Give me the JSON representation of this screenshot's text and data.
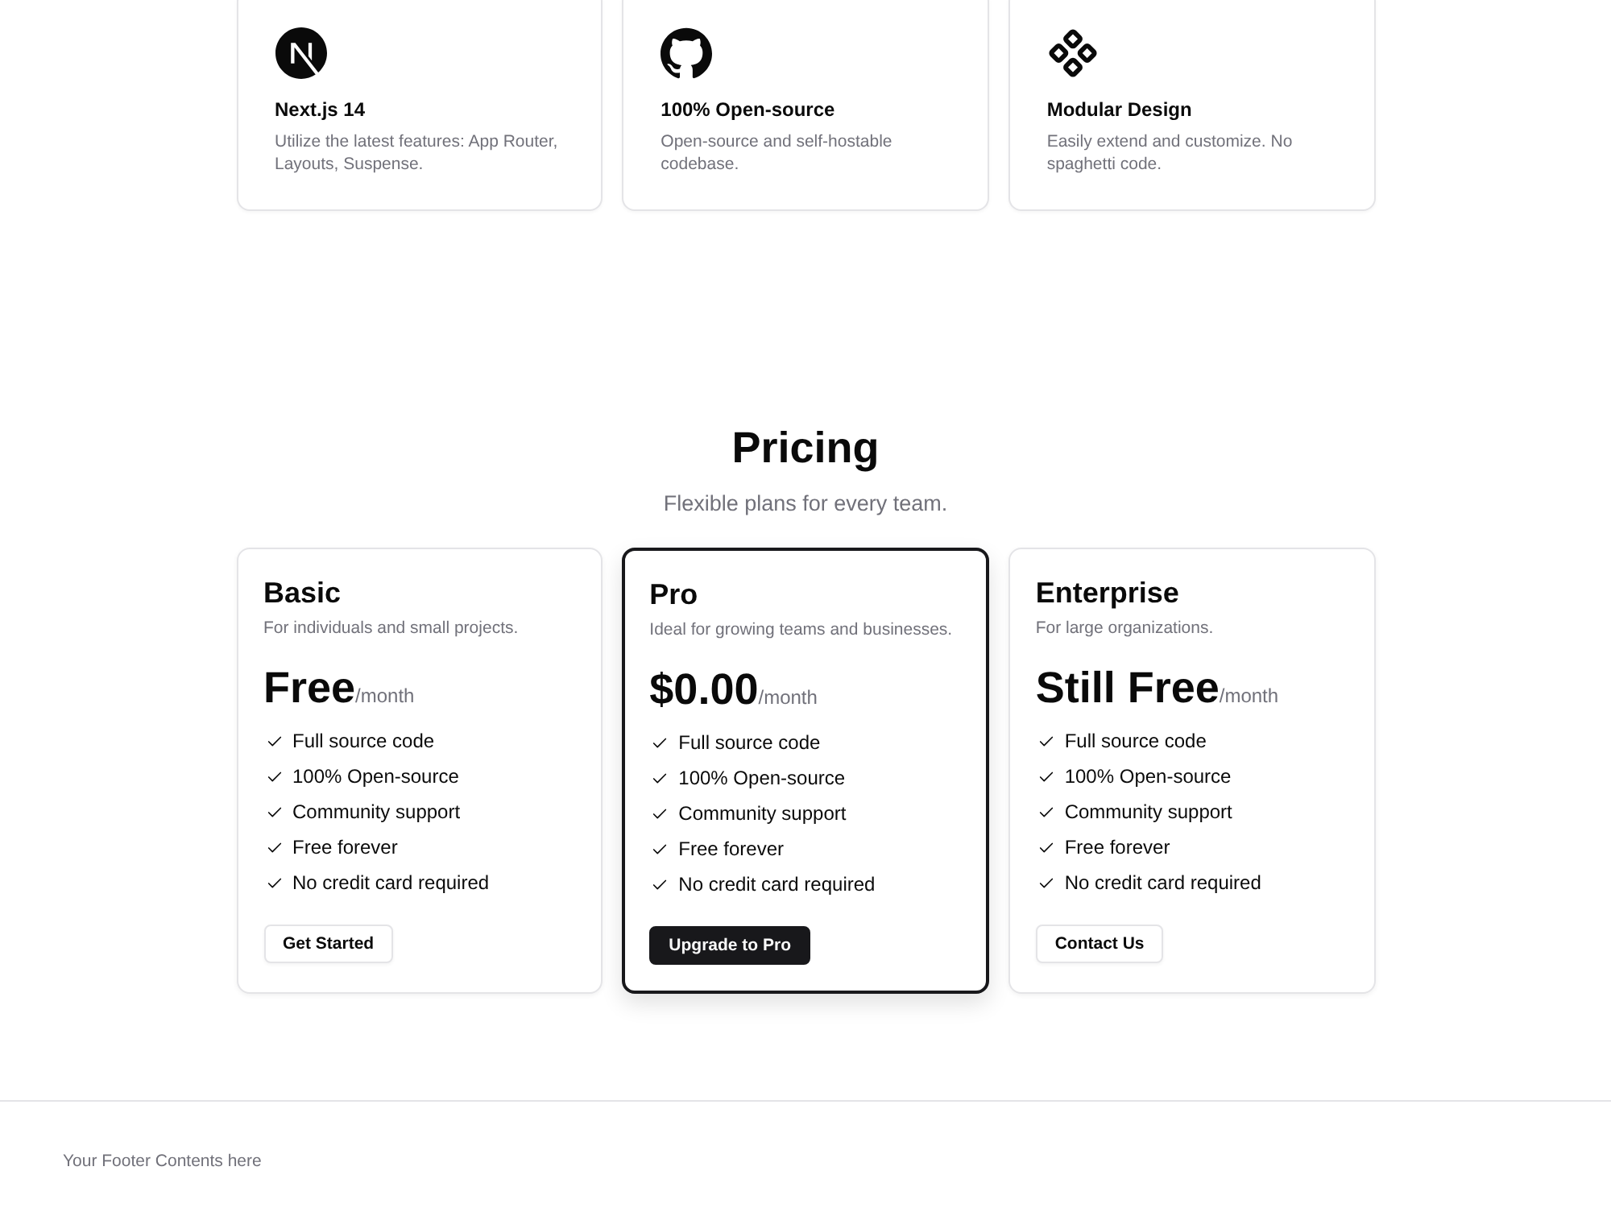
{
  "features": [
    {
      "title": "Next.js 14",
      "description": "Utilize the latest features: App Router, Layouts, Suspense."
    },
    {
      "title": "100% Open-source",
      "description": "Open-source and self-hostable codebase."
    },
    {
      "title": "Modular Design",
      "description": "Easily extend and customize. No spaghetti code."
    }
  ],
  "pricing": {
    "title": "Pricing",
    "subtitle": "Flexible plans for every team.",
    "plans": [
      {
        "name": "Basic",
        "description": "For individuals and small projects.",
        "price": "Free",
        "period": "/month",
        "highlighted": false,
        "features": [
          "Full source code",
          "100% Open-source",
          "Community support",
          "Free forever",
          "No credit card required"
        ],
        "button": {
          "label": "Get Started",
          "kind": "outline"
        }
      },
      {
        "name": "Pro",
        "description": "Ideal for growing teams and businesses.",
        "price": "$0.00",
        "period": "/month",
        "highlighted": true,
        "features": [
          "Full source code",
          "100% Open-source",
          "Community support",
          "Free forever",
          "No credit card required"
        ],
        "button": {
          "label": "Upgrade to Pro",
          "kind": "primary"
        }
      },
      {
        "name": "Enterprise",
        "description": "For large organizations.",
        "price": "Still Free",
        "period": "/month",
        "highlighted": false,
        "features": [
          "Full source code",
          "100% Open-source",
          "Community support",
          "Free forever",
          "No credit card required"
        ],
        "button": {
          "label": "Contact Us",
          "kind": "outline"
        }
      }
    ]
  },
  "footer": {
    "text": "Your Footer Contents here"
  }
}
